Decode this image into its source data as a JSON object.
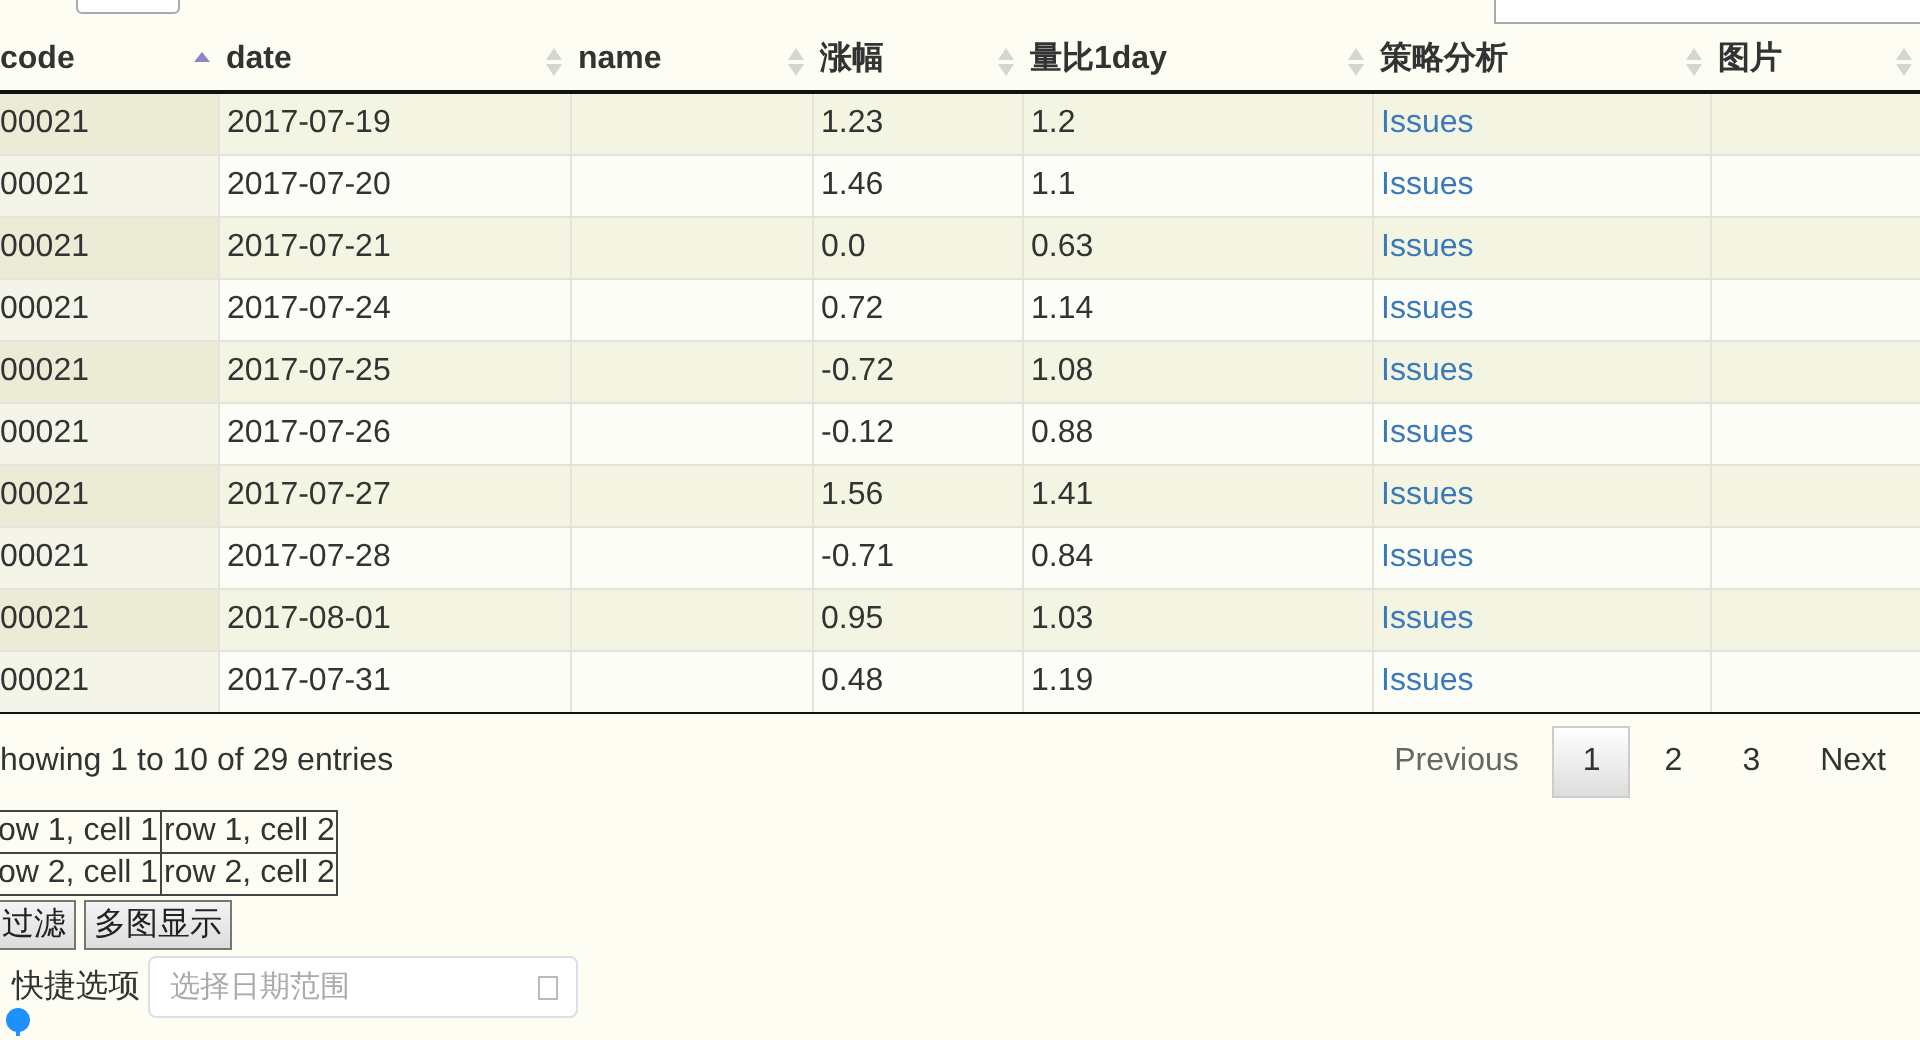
{
  "table": {
    "columns": [
      {
        "label": "code",
        "sorted": true
      },
      {
        "label": "date",
        "sorted": false
      },
      {
        "label": "name",
        "sorted": false
      },
      {
        "label": "涨幅",
        "sorted": false
      },
      {
        "label": "量比1day",
        "sorted": false
      },
      {
        "label": "策略分析",
        "sorted": false
      },
      {
        "label": "图片",
        "sorted": false
      }
    ],
    "rows": [
      {
        "cells": [
          "00021",
          "2017-07-19",
          "",
          "1.23",
          "1.2"
        ],
        "link": "Issues"
      },
      {
        "cells": [
          "00021",
          "2017-07-20",
          "",
          "1.46",
          "1.1"
        ],
        "link": "Issues"
      },
      {
        "cells": [
          "00021",
          "2017-07-21",
          "",
          "0.0",
          "0.63"
        ],
        "link": "Issues"
      },
      {
        "cells": [
          "00021",
          "2017-07-24",
          "",
          "0.72",
          "1.14"
        ],
        "link": "Issues"
      },
      {
        "cells": [
          "00021",
          "2017-07-25",
          "",
          "-0.72",
          "1.08"
        ],
        "link": "Issues"
      },
      {
        "cells": [
          "00021",
          "2017-07-26",
          "",
          "-0.12",
          "0.88"
        ],
        "link": "Issues"
      },
      {
        "cells": [
          "00021",
          "2017-07-27",
          "",
          "1.56",
          "1.41"
        ],
        "link": "Issues"
      },
      {
        "cells": [
          "00021",
          "2017-07-28",
          "",
          "-0.71",
          "0.84"
        ],
        "link": "Issues"
      },
      {
        "cells": [
          "00021",
          "2017-08-01",
          "",
          "0.95",
          "1.03"
        ],
        "link": "Issues"
      },
      {
        "cells": [
          "00021",
          "2017-07-31",
          "",
          "0.48",
          "1.19"
        ],
        "link": "Issues"
      }
    ]
  },
  "info": "howing 1 to 10 of 29 entries",
  "pagination": {
    "previous": "Previous",
    "next": "Next",
    "pages": [
      {
        "label": "1",
        "selected": true
      },
      {
        "label": "2",
        "selected": false
      },
      {
        "label": "3",
        "selected": false
      }
    ]
  },
  "small_table": [
    [
      "ow 1, cell 1",
      "row 1, cell 2"
    ],
    [
      "ow 2, cell 1",
      "row 2, cell 2"
    ]
  ],
  "buttons": [
    "过滤",
    "多图显示"
  ],
  "date_range": {
    "label": "快捷选项",
    "placeholder": "选择日期范围"
  }
}
